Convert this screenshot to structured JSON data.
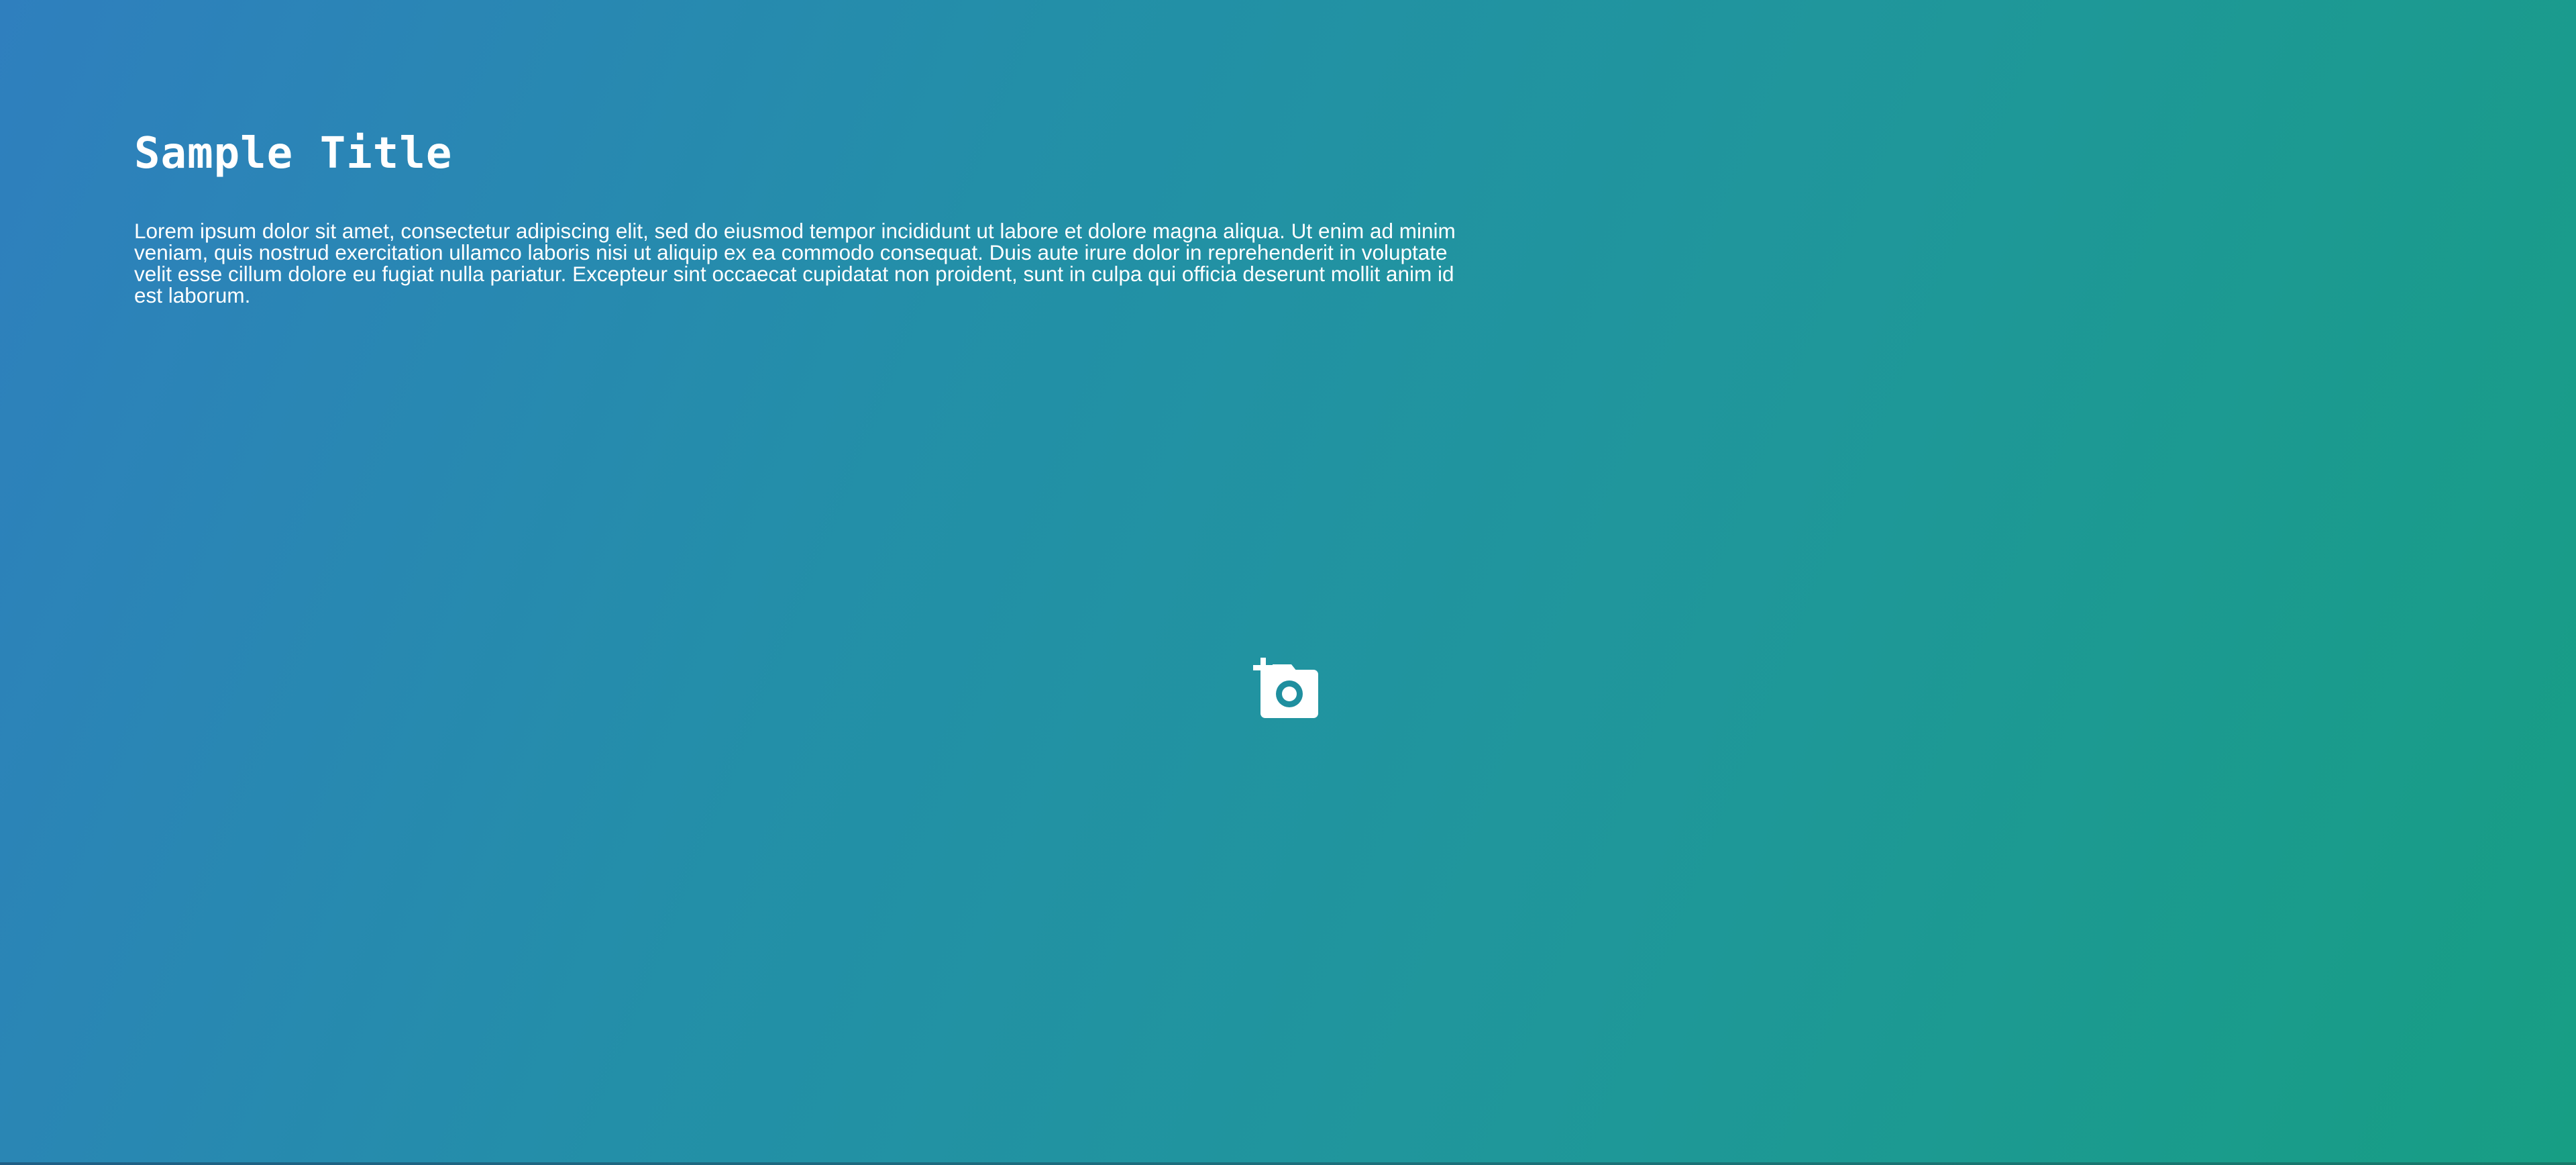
{
  "page": {
    "title": "Sample Title",
    "body": "Lorem ipsum dolor sit amet, consectetur adipiscing elit, sed do eiusmod tempor incididunt ut labore et dolore magna aliqua. Ut enim ad minim veniam, quis nostrud exercitation ullamco laboris nisi ut aliquip ex ea commodo consequat. Duis aute irure dolor in reprehenderit in voluptate velit esse cillum dolore eu fugiat nulla pariatur. Excepteur sint occaecat cupidatat non proident, sunt in culpa qui officia deserunt mollit anim id est laborum."
  },
  "upload": {
    "icon": "add-photo-icon"
  },
  "colors": {
    "gradient_start": "#2f7fbe",
    "gradient_end": "#179e84",
    "text": "#ffffff"
  }
}
